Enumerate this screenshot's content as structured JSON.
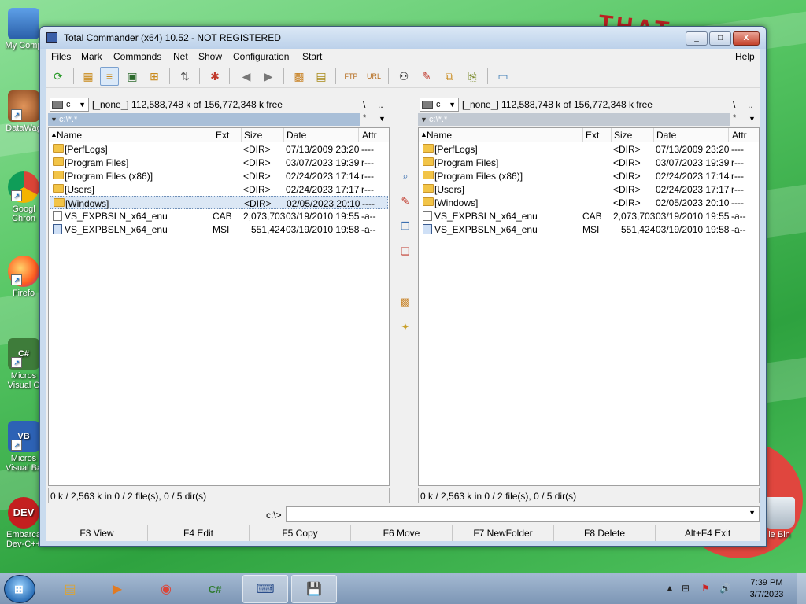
{
  "window": {
    "title": "Total Commander (x64) 10.52 - NOT REGISTERED",
    "minimize": "_",
    "maximize": "□",
    "close": "X"
  },
  "menu": [
    "Files",
    "Mark",
    "Commands",
    "Net",
    "Show",
    "Configuration",
    "Start",
    "Help"
  ],
  "left_panel": {
    "drive": "c",
    "drive_info": "[_none_]  112,588,748 k of 156,772,348 k free",
    "root": "\\",
    "parent": "..",
    "path": "c:\\*.*",
    "filter": "*",
    "columns": {
      "name": "Name",
      "ext": "Ext",
      "size": "Size",
      "date": "Date",
      "attr": "Attr"
    },
    "rows": [
      {
        "name": "[PerfLogs]",
        "ext": "",
        "size": "<DIR>",
        "date": "07/13/2009 23:20",
        "attr": "----"
      },
      {
        "name": "[Program Files]",
        "ext": "",
        "size": "<DIR>",
        "date": "03/07/2023 19:39",
        "attr": "r---"
      },
      {
        "name": "[Program Files (x86)]",
        "ext": "",
        "size": "<DIR>",
        "date": "02/24/2023 17:14",
        "attr": "r---"
      },
      {
        "name": "[Users]",
        "ext": "",
        "size": "<DIR>",
        "date": "02/24/2023 17:17",
        "attr": "r---"
      },
      {
        "name": "[Windows]",
        "ext": "",
        "size": "<DIR>",
        "date": "02/05/2023 20:10",
        "attr": "----"
      },
      {
        "name": "VS_EXPBSLN_x64_enu",
        "ext": "CAB",
        "size": "2,073,703",
        "date": "03/19/2010 19:55",
        "attr": "-a--"
      },
      {
        "name": "VS_EXPBSLN_x64_enu",
        "ext": "MSI",
        "size": "551,424",
        "date": "03/19/2010 19:58",
        "attr": "-a--"
      }
    ],
    "status": "0 k / 2,563 k in 0 / 2 file(s), 0 / 5 dir(s)"
  },
  "right_panel": {
    "drive": "c",
    "drive_info": "[_none_]  112,588,748 k of 156,772,348 k free",
    "root": "\\",
    "parent": "..",
    "path": "c:\\*.*",
    "filter": "*",
    "columns": {
      "name": "Name",
      "ext": "Ext",
      "size": "Size",
      "date": "Date",
      "attr": "Attr"
    },
    "rows": [
      {
        "name": "[PerfLogs]",
        "ext": "",
        "size": "<DIR>",
        "date": "07/13/2009 23:20",
        "attr": "----"
      },
      {
        "name": "[Program Files]",
        "ext": "",
        "size": "<DIR>",
        "date": "03/07/2023 19:39",
        "attr": "r---"
      },
      {
        "name": "[Program Files (x86)]",
        "ext": "",
        "size": "<DIR>",
        "date": "02/24/2023 17:14",
        "attr": "r---"
      },
      {
        "name": "[Users]",
        "ext": "",
        "size": "<DIR>",
        "date": "02/24/2023 17:17",
        "attr": "r---"
      },
      {
        "name": "[Windows]",
        "ext": "",
        "size": "<DIR>",
        "date": "02/05/2023 20:10",
        "attr": "----"
      },
      {
        "name": "VS_EXPBSLN_x64_enu",
        "ext": "CAB",
        "size": "2,073,703",
        "date": "03/19/2010 19:55",
        "attr": "-a--"
      },
      {
        "name": "VS_EXPBSLN_x64_enu",
        "ext": "MSI",
        "size": "551,424",
        "date": "03/19/2010 19:58",
        "attr": "-a--"
      }
    ],
    "status": "0 k / 2,563 k in 0 / 2 file(s), 0 / 5 dir(s)"
  },
  "command_line": {
    "label": "c:\\>",
    "value": ""
  },
  "function_keys": [
    "F3 View",
    "F4 Edit",
    "F5 Copy",
    "F6 Move",
    "F7 NewFolder",
    "F8 Delete",
    "Alt+F4 Exit"
  ],
  "desktop_icons": [
    "My Comp",
    "DataWag",
    "Googl Chron",
    "Firefo",
    "Micros Visual C",
    "Micros Visual Ba",
    "Embarca Dev-C++"
  ],
  "recycle_bin_label": "le Bin",
  "taskbar": {
    "time": "7:39 PM",
    "date": "3/7/2023",
    "apps": [
      "explorer-icon",
      "media-player-icon",
      "chrome-icon",
      "csharp-icon",
      "keyboard-app-icon",
      "total-commander-icon"
    ]
  },
  "wallpaper_text": "THAT"
}
